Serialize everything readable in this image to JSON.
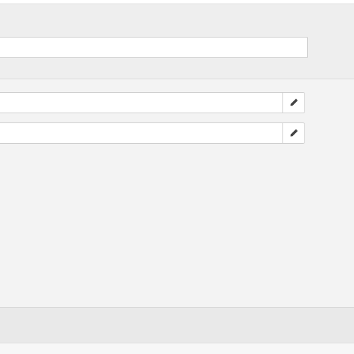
{
  "header": {
    "input": {
      "value": "",
      "placeholder": ""
    }
  },
  "fields": [
    {
      "value": "",
      "placeholder": "",
      "action_icon": "pencil-icon"
    },
    {
      "value": "",
      "placeholder": "",
      "action_icon": "pencil-icon"
    }
  ],
  "colors": {
    "background": "#f0f0f0",
    "input_background": "#ffffff",
    "border": "#cccccc",
    "icon": "#444444"
  }
}
